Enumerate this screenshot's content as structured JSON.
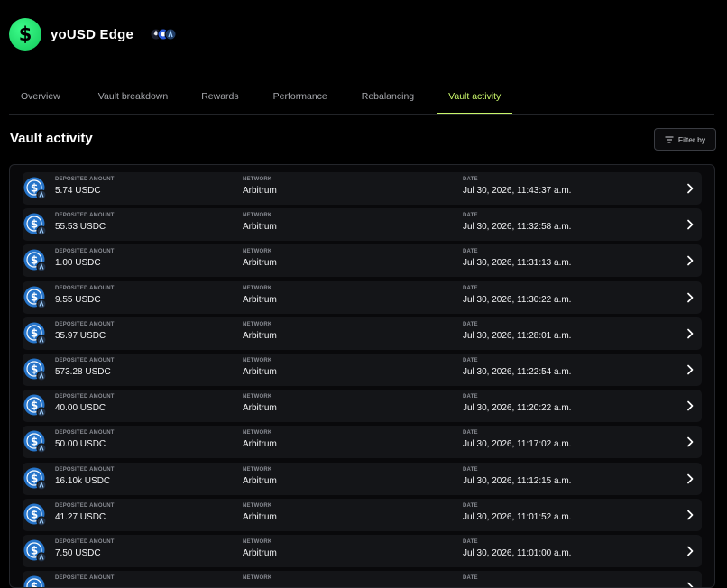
{
  "vault": {
    "name": "yoUSD Edge",
    "brand_color": "#22e06a"
  },
  "tabs": [
    {
      "label": "Overview",
      "active": false
    },
    {
      "label": "Vault breakdown",
      "active": false
    },
    {
      "label": "Rewards",
      "active": false
    },
    {
      "label": "Performance",
      "active": false
    },
    {
      "label": "Rebalancing",
      "active": false
    },
    {
      "label": "Vault activity",
      "active": true
    }
  ],
  "accent_color": "#c8f56a",
  "section": {
    "title": "Vault activity",
    "filter_label": "Filter by"
  },
  "columns": {
    "amount": "DEPOSITED AMOUNT",
    "network": "NETWORK",
    "date": "DATE"
  },
  "rows": [
    {
      "amount": "5.74 USDC",
      "network": "Arbitrum",
      "date": "Jul 30, 2026, 11:43:37 a.m."
    },
    {
      "amount": "55.53 USDC",
      "network": "Arbitrum",
      "date": "Jul 30, 2026, 11:32:58 a.m."
    },
    {
      "amount": "1.00 USDC",
      "network": "Arbitrum",
      "date": "Jul 30, 2026, 11:31:13 a.m."
    },
    {
      "amount": "9.55 USDC",
      "network": "Arbitrum",
      "date": "Jul 30, 2026, 11:30:22 a.m."
    },
    {
      "amount": "35.97 USDC",
      "network": "Arbitrum",
      "date": "Jul 30, 2026, 11:28:01 a.m."
    },
    {
      "amount": "573.28 USDC",
      "network": "Arbitrum",
      "date": "Jul 30, 2026, 11:22:54 a.m."
    },
    {
      "amount": "40.00 USDC",
      "network": "Arbitrum",
      "date": "Jul 30, 2026, 11:20:22 a.m."
    },
    {
      "amount": "50.00 USDC",
      "network": "Arbitrum",
      "date": "Jul 30, 2026, 11:17:02 a.m."
    },
    {
      "amount": "16.10k USDC",
      "network": "Arbitrum",
      "date": "Jul 30, 2026, 11:12:15 a.m."
    },
    {
      "amount": "41.27 USDC",
      "network": "Arbitrum",
      "date": "Jul 30, 2026, 11:01:52 a.m."
    },
    {
      "amount": "7.50 USDC",
      "network": "Arbitrum",
      "date": "Jul 30, 2026, 11:01:00 a.m."
    },
    {
      "amount": "",
      "network": "",
      "date": ""
    }
  ],
  "icons": {
    "row_coin": "usdc-icon",
    "row_network": "arbitrum-icon",
    "row_arrow": "chevron-right-icon",
    "filter": "filter-icon"
  }
}
